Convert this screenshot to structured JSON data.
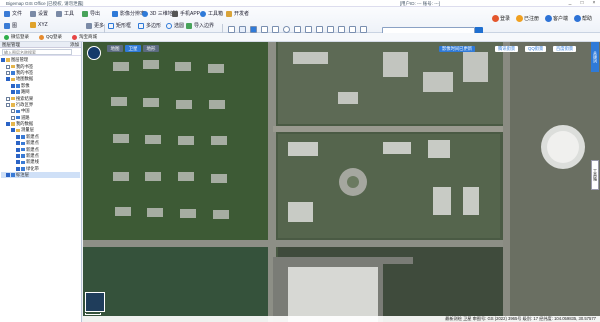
{
  "titlebar": {
    "title": "Bigemap GIS Office [已授权, 请勿泄露]",
    "login_info": "[用户ID: --- 账号: ---]",
    "controls": [
      "_",
      "□",
      "×"
    ]
  },
  "menubar": {
    "items": [
      {
        "label": "文件",
        "icon": "file-icon"
      },
      {
        "label": "设置",
        "icon": "settings-icon"
      },
      {
        "label": "工具",
        "icon": "tool-icon"
      },
      {
        "label": "导出",
        "icon": "export-icon"
      },
      {
        "label": "影像分辨率",
        "icon": "layers-icon"
      },
      {
        "label": "3D 三维地球",
        "icon": "globe-icon"
      },
      {
        "label": "手机APP",
        "icon": "phone-icon"
      },
      {
        "label": "工具箱",
        "icon": "gear-icon"
      },
      {
        "label": "开发者",
        "icon": "code-icon"
      }
    ],
    "row2": [
      {
        "label": "图",
        "icon": "map-icon"
      },
      {
        "label": "XYZ",
        "icon": "xyz-icon"
      },
      {
        "label": "更多",
        "icon": "more-icon"
      },
      {
        "label": "矩形框",
        "icon": "rect-icon"
      },
      {
        "label": "多边形",
        "icon": "polygon-icon"
      },
      {
        "label": "选圆",
        "icon": "circle-icon"
      },
      {
        "label": "导入边界",
        "icon": "import-icon"
      }
    ],
    "search_placeholder": "",
    "account_buttons": [
      {
        "label": "登录",
        "color": "#e4572e"
      },
      {
        "label": "已注册",
        "color": "#f0a020"
      },
      {
        "label": "客户端",
        "color": "#2e73d6"
      },
      {
        "label": "帮助",
        "color": "#2e73d6"
      }
    ]
  },
  "subbar": {
    "items": [
      {
        "label": "微信登录",
        "color": "#2fae4a"
      },
      {
        "label": "QQ登录",
        "color": "#e68b2f"
      },
      {
        "label": "淘宝商城",
        "color": "#e64545"
      }
    ]
  },
  "panel": {
    "title": "图层管理",
    "close": "添加",
    "search_placeholder": "输入图层名称搜索",
    "tree": [
      {
        "label": "图层管理",
        "level": 0,
        "checked": true,
        "folder": true
      },
      {
        "label": "我的书签",
        "level": 1,
        "checked": false,
        "folder": true
      },
      {
        "label": "我的书签",
        "level": 1,
        "checked": false,
        "folder": false
      },
      {
        "label": "地图数据",
        "level": 1,
        "checked": true,
        "folder": true
      },
      {
        "label": "影像",
        "level": 2,
        "checked": true,
        "folder": false
      },
      {
        "label": "路网",
        "level": 2,
        "checked": true,
        "folder": false
      },
      {
        "label": "搜索结果",
        "level": 1,
        "checked": false,
        "folder": true
      },
      {
        "label": "行政区界",
        "level": 1,
        "checked": false,
        "folder": true
      },
      {
        "label": "中国",
        "level": 2,
        "checked": false,
        "folder": false
      },
      {
        "label": "道路",
        "level": 2,
        "checked": false,
        "folder": false
      },
      {
        "label": "我的数据",
        "level": 1,
        "checked": true,
        "folder": true
      },
      {
        "label": "测量层",
        "level": 2,
        "checked": true,
        "folder": true
      },
      {
        "label": "新建点",
        "level": 3,
        "checked": true,
        "folder": false
      },
      {
        "label": "新建点",
        "level": 3,
        "checked": true,
        "folder": false
      },
      {
        "label": "新建点",
        "level": 3,
        "checked": true,
        "folder": false
      },
      {
        "label": "新建点",
        "level": 3,
        "checked": true,
        "folder": false
      },
      {
        "label": "新建线",
        "level": 3,
        "checked": true,
        "folder": false
      },
      {
        "label": "绿化带",
        "level": 3,
        "checked": true,
        "folder": false
      },
      {
        "label": "标注层",
        "level": 1,
        "checked": true,
        "folder": false,
        "selected": true
      }
    ]
  },
  "map": {
    "tabs": [
      {
        "label": "地图",
        "active": false
      },
      {
        "label": "卫星",
        "active": true
      },
      {
        "label": "地形",
        "active": false
      }
    ],
    "logo_text": "BIGEMAP",
    "pills": [
      {
        "label": "影像时间已更新",
        "bg": "#2f7ad8",
        "color": "#ffffff"
      },
      {
        "label": "腾讯街景",
        "bg": "#ffffff",
        "color": "#2f7ad8"
      },
      {
        "label": "QQ街景",
        "bg": "#ffffff",
        "color": "#2f7ad8"
      },
      {
        "label": "百度街景",
        "bg": "#ffffff",
        "color": "#2f7ad8"
      }
    ],
    "side_button": "关键词",
    "right_vlabel": "工具箱",
    "status": "最新测绘 卫星  审图号: GS (2022) 3965号  级别: 17  经纬度: 104.059835, 30.57577"
  }
}
